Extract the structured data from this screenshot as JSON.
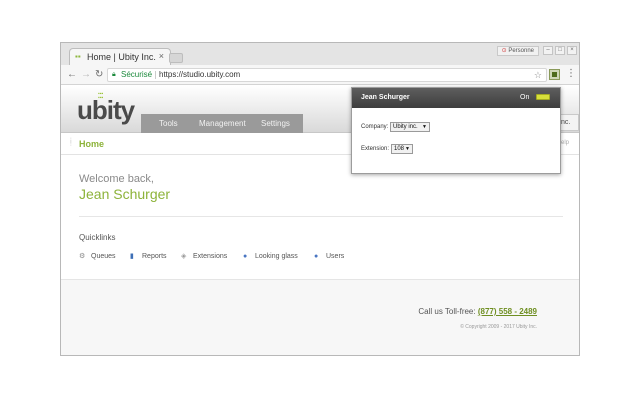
{
  "browser": {
    "tab_title": "Home | Ubity Inc.",
    "tab_close": "×",
    "profile_label": "Personne",
    "address": {
      "secure_label": "Sécurisé",
      "url": "https://studio.ubity.com"
    },
    "nav": {
      "back": "←",
      "forward": "→",
      "reload": "↻"
    }
  },
  "site": {
    "logo": "ubity",
    "menu": [
      "Tools",
      "Management",
      "Settings"
    ],
    "header_right_label": "nc.",
    "home_link": "Home",
    "help_link": "elp",
    "welcome_text": "Welcome back,",
    "user_name": "Jean Schurger",
    "quicklinks_title": "Quicklinks",
    "quicklinks": [
      {
        "label": "Queues",
        "icon": "gear-icon"
      },
      {
        "label": "Reports",
        "icon": "bar-chart-icon"
      },
      {
        "label": "Extensions",
        "icon": "cube-icon"
      },
      {
        "label": "Looking glass",
        "icon": "user-search-icon"
      },
      {
        "label": "Users",
        "icon": "user-icon"
      }
    ],
    "footer": {
      "call_label": "Call us Toll-free:",
      "phone": "(877) 558 - 2489",
      "copyright": "© Copyright 2009 - 2017 Ubity Inc."
    }
  },
  "popup": {
    "user_name": "Jean Schurger",
    "status": "On",
    "company_label": "Company:",
    "company_value": "Ubity inc.",
    "extension_label": "Extension:",
    "extension_value": "108"
  },
  "colors": {
    "brand_green": "#8db33a",
    "popup_header": "#4a4a4a",
    "toggle": "#d6df3a"
  }
}
